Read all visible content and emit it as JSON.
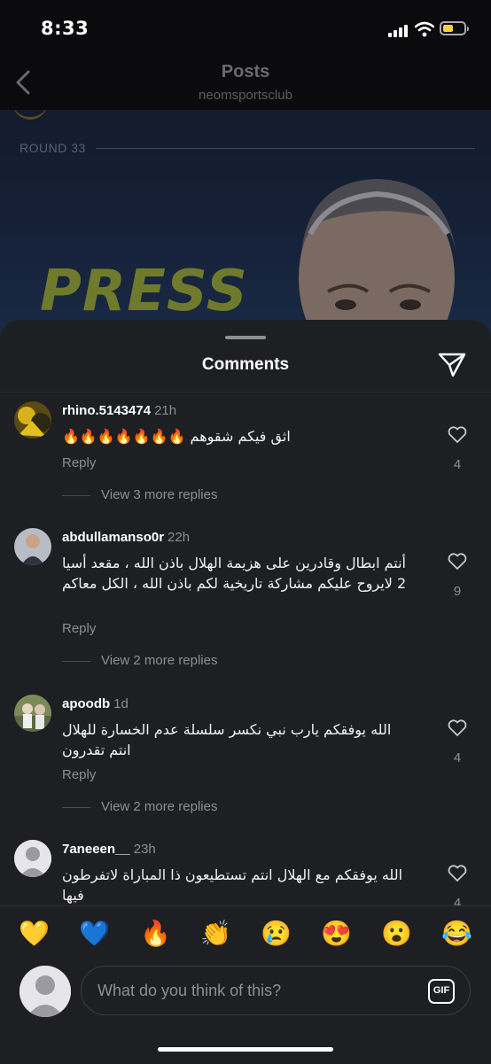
{
  "status": {
    "time": "8:33"
  },
  "nav": {
    "title": "Posts",
    "subtitle": "neomsportsclub"
  },
  "post": {
    "round_label": "ROUND 33",
    "headline": "PRESS"
  },
  "sheet": {
    "title": "Comments"
  },
  "comments": [
    {
      "username": "rhino.5143474",
      "time": "21h",
      "text": "اثق فيكم شقوهم 🔥🔥🔥🔥🔥🔥🔥",
      "reply": "Reply",
      "likes": "4",
      "view_more": "View 3 more replies"
    },
    {
      "username": "abdullamanso0r",
      "time": "22h",
      "text": "أنتم ابطال وقادرين على هزيمة الهلال باذن الله ، مقعد أسيا 2 لايروح عليكم مشاركة تاريخية لكم باذن الله ، الكل معاكم",
      "reply": "Reply",
      "likes": "9",
      "view_more": "View 2 more replies"
    },
    {
      "username": "apoodb",
      "time": "1d",
      "text": "الله يوفقكم يارب نبي نكسر سلسلة عدم الخسارة للهلال انتم تقدرون",
      "reply": "Reply",
      "likes": "4",
      "view_more": "View 2 more replies"
    },
    {
      "username": "7aneeen__",
      "time": "23h",
      "text": "الله يوفقكم مع الهلال انتم تستطيعون ذا المباراة لاتفرطون فيها",
      "likes": "4"
    }
  ],
  "emojis": [
    "💛",
    "💙",
    "🔥",
    "👏",
    "😢",
    "😍",
    "😮",
    "😂"
  ],
  "composer": {
    "placeholder": "What do you think of this?",
    "gif_label": "GIF"
  },
  "colors": {
    "sheet_bg": "#1e1f23",
    "muted": "#8e8e93",
    "battery": "#f6d146"
  }
}
